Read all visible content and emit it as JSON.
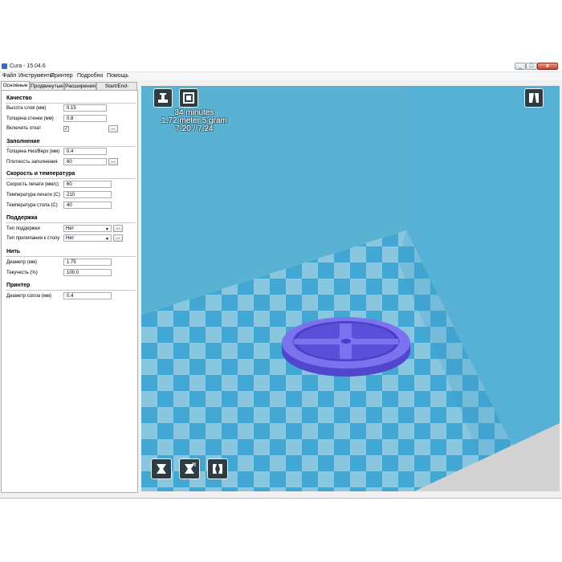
{
  "window": {
    "title": "Cura - 15.04.6",
    "minimize_label": "_",
    "maximize_label": "□",
    "close_label": "x"
  },
  "menu": [
    "Файл",
    "Инструменты",
    "Принтер",
    "Подробно",
    "Помощь"
  ],
  "tabs": [
    "Основные",
    "Продвинутые",
    "Расширения",
    "Start/End-GCode"
  ],
  "sections": {
    "quality": {
      "title": "Качество",
      "layer_height_label": "Высота слоя (мм)",
      "layer_height": "0.15",
      "wall_thickness_label": "Толщина стенки (мм)",
      "wall_thickness": "0.8",
      "retraction_label": "Включить откат",
      "retraction_checked": "✓"
    },
    "fill": {
      "title": "Заполнение",
      "bottom_top_label": "Толщина Низ/Верх (мм)",
      "bottom_top": "0.4",
      "density_label": "Плотность заполнения",
      "density": "60"
    },
    "speed": {
      "title": "Скорость и температура",
      "print_speed_label": "Скорость печати (мм/с)",
      "print_speed": "60",
      "print_temp_label": "Температура печати (С)",
      "print_temp": "210",
      "bed_temp_label": "Температура стола (С)",
      "bed_temp": "40"
    },
    "support": {
      "title": "Поддержка",
      "support_type_label": "Тип поддержки",
      "support_type": "Нет",
      "adhesion_label": "Тип прилипания к столу",
      "adhesion": "Нет"
    },
    "filament": {
      "title": "Нить",
      "diameter_label": "Диаметр (мм)",
      "diameter": "1.75",
      "flow_label": "Текучесть (%)",
      "flow": "100.0"
    },
    "machine": {
      "title": "Принтер",
      "nozzle_label": "Диаметр сопла (мм)",
      "nozzle": "0.4"
    }
  },
  "dots_label": "...",
  "print_stats": {
    "time": "34 minutes",
    "filament": "1.72 meter 5 gram",
    "cost": "7.20 / 7.24"
  },
  "icons": {
    "load": "load-model-icon",
    "save": "save-gcode-icon",
    "view_mode": "view-mode-icon",
    "rotate": "rotate-icon",
    "scale": "scale-icon",
    "mirror": "mirror-icon"
  },
  "colors": {
    "back_wall": "#5ab2d2",
    "bed_light": "#89c7e0",
    "bed_dark": "#43a7d3",
    "model": "#7c72f0",
    "model_dark": "#5246cc",
    "icon_bg": "#2e3d43"
  }
}
